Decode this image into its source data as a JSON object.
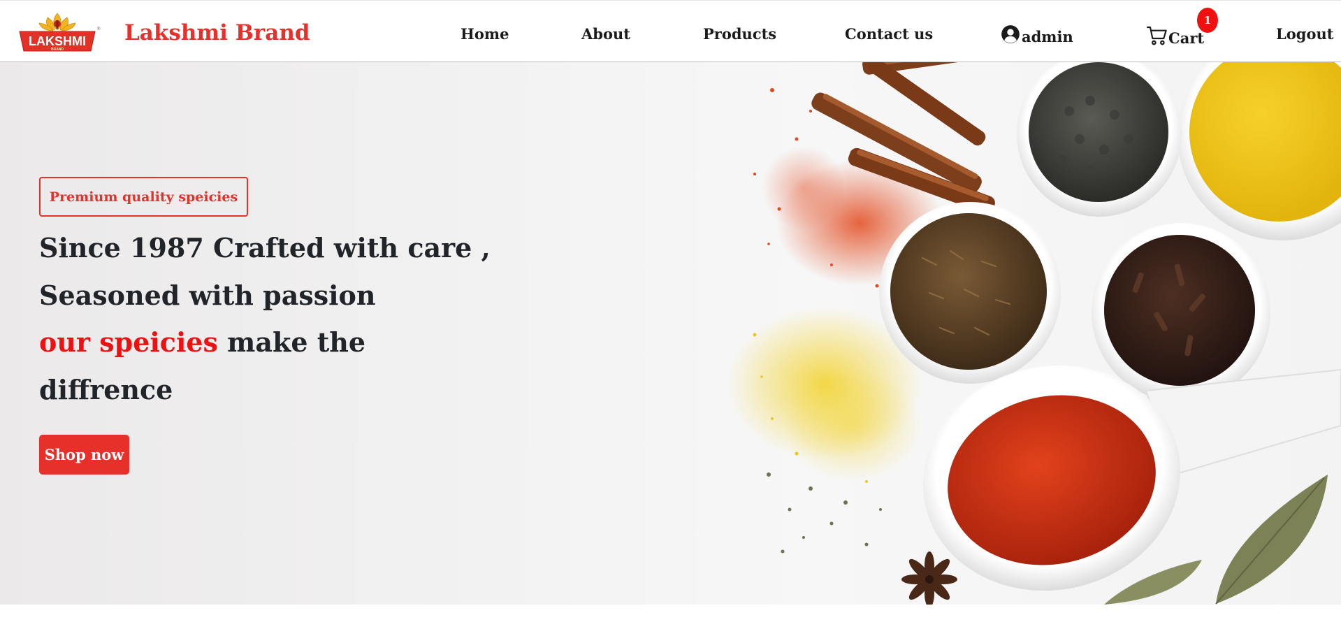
{
  "brand": {
    "logo_text": "LAKSHMI",
    "logo_subtext": "BRAND",
    "name": "Lakshmi Brand"
  },
  "nav": {
    "home": "Home",
    "about": "About",
    "products": "Products",
    "contact": "Contact us",
    "user": "admin",
    "cart": "Cart",
    "cart_count": "1",
    "logout": "Logout"
  },
  "hero": {
    "badge": "Premium quality speicies",
    "line1": "Since 1987 Crafted with care ,",
    "line2": "Seasoned with passion",
    "accent": "our speicies",
    "line3_rest": " make the",
    "line4": "diffrence",
    "cta": "Shop now"
  },
  "colors": {
    "brand_red": "#e8302b",
    "accent_red": "#ee1111",
    "badge_red": "#f01010",
    "text_dark": "#212529"
  },
  "icons": {
    "user": "user-circle-icon",
    "cart": "shopping-cart-icon"
  }
}
